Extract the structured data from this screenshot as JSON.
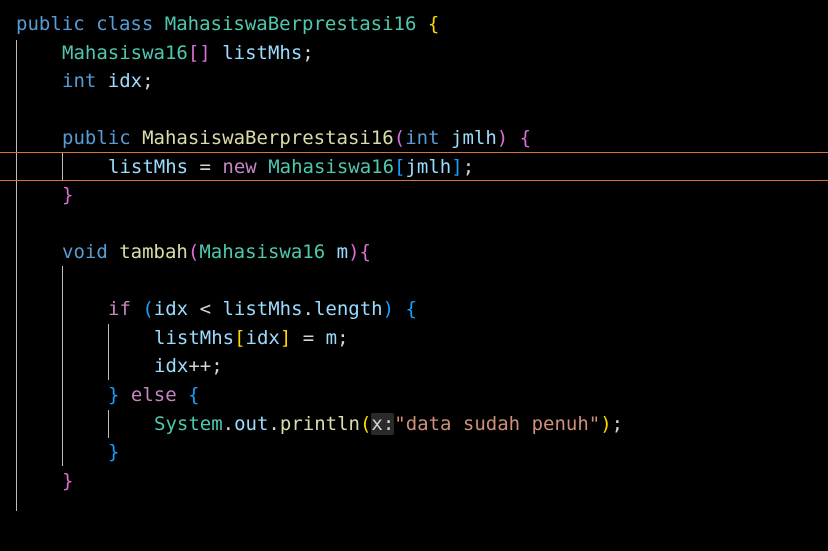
{
  "editor": {
    "language": "java",
    "colors": {
      "background": "#000000",
      "keyword": "#569cd6",
      "control": "#c586c0",
      "type": "#4ec9b0",
      "function": "#dcdcaa",
      "variable": "#9cdcfe",
      "string": "#ce9178",
      "bracket_level_1": "#ffd700",
      "bracket_level_2": "#da70d6",
      "bracket_level_3": "#179fff",
      "current_line_border": "#d8733a"
    },
    "lines": [
      {
        "tokens": [
          "public",
          " ",
          "class",
          " ",
          "MahasiswaBerprestasi16",
          " ",
          "{"
        ]
      },
      {
        "tokens": [
          "Mahasiswa16",
          "[]",
          " ",
          "listMhs",
          ";"
        ]
      },
      {
        "tokens": [
          "int",
          " ",
          "idx",
          ";"
        ]
      },
      {
        "tokens": []
      },
      {
        "tokens": [
          "public",
          " ",
          "MahasiswaBerprestasi16",
          "(",
          "int",
          " ",
          "jmlh",
          ")",
          " ",
          "{"
        ]
      },
      {
        "tokens": [
          "listMhs",
          " = ",
          "new",
          " ",
          "Mahasiswa16",
          "[",
          "jmlh",
          "]",
          ";"
        ]
      },
      {
        "tokens": [
          "}"
        ]
      },
      {
        "tokens": []
      },
      {
        "tokens": [
          "void",
          " ",
          "tambah",
          "(",
          "Mahasiswa16",
          " ",
          "m",
          ")",
          "{"
        ]
      },
      {
        "tokens": []
      },
      {
        "tokens": [
          "if",
          " ",
          "(",
          "idx",
          " < ",
          "listMhs",
          ".",
          "length",
          ")",
          " ",
          "{"
        ]
      },
      {
        "tokens": [
          "listMhs",
          "[",
          "idx",
          "]",
          " = ",
          "m",
          ";"
        ]
      },
      {
        "tokens": [
          "idx",
          "++;"
        ]
      },
      {
        "tokens": [
          "}",
          " ",
          "else",
          " ",
          "{"
        ]
      },
      {
        "tokens": [
          "System",
          ".",
          "out",
          ".",
          "println",
          "(",
          "x:",
          "\"data sudah penuh\"",
          ")",
          ";"
        ]
      },
      {
        "tokens": [
          "}"
        ]
      },
      {
        "tokens": [
          "}"
        ]
      }
    ]
  }
}
